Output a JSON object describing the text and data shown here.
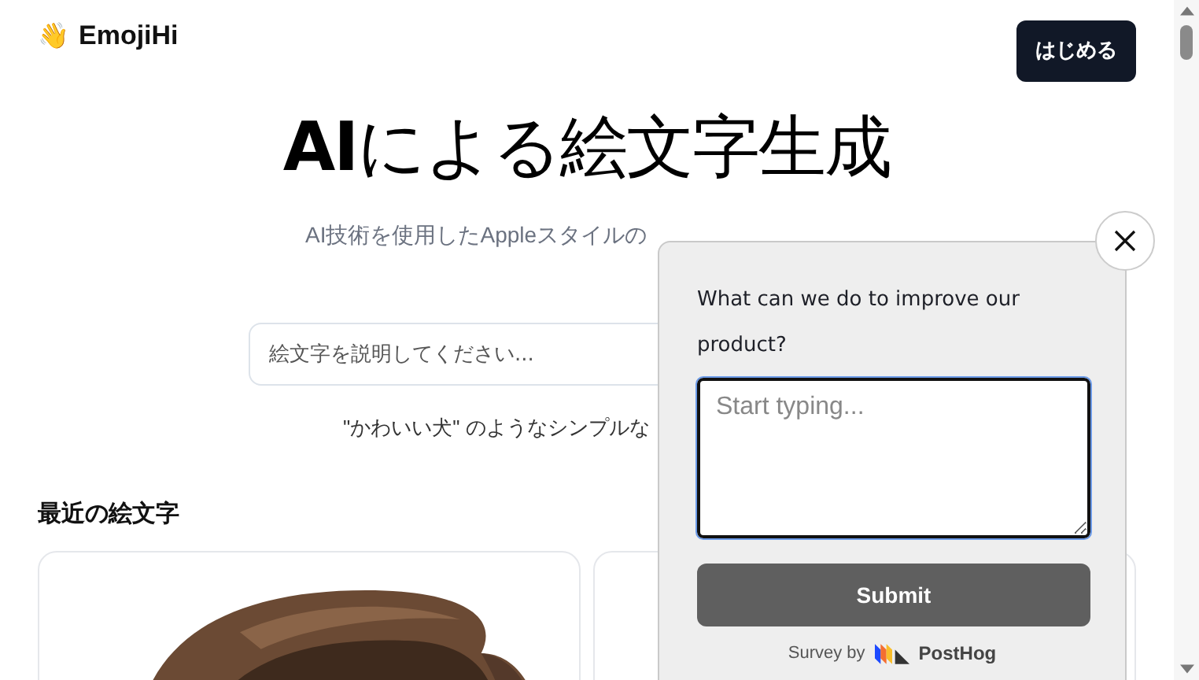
{
  "header": {
    "logo_emoji": "👋",
    "logo_text": "EmojiHi",
    "cta": "はじめる"
  },
  "hero": {
    "title_bold": "AI",
    "title_rest": "による絵文字生成",
    "subtitle": "AI技術を使用したAppleスタイルの",
    "input": {
      "placeholder": "絵文字を説明してください..."
    },
    "hint": "\"かわいい犬\" のようなシンプルな"
  },
  "recent": {
    "heading": "最近の絵文字",
    "cards": [
      {
        "kind": "picture"
      },
      {
        "kind": "empty"
      }
    ]
  },
  "survey": {
    "question": "What can we do to improve our product?",
    "answer": {
      "placeholder": "Start typing..."
    },
    "submit": "Submit",
    "footer_prefix": "Survey by",
    "brand": "PostHog"
  }
}
